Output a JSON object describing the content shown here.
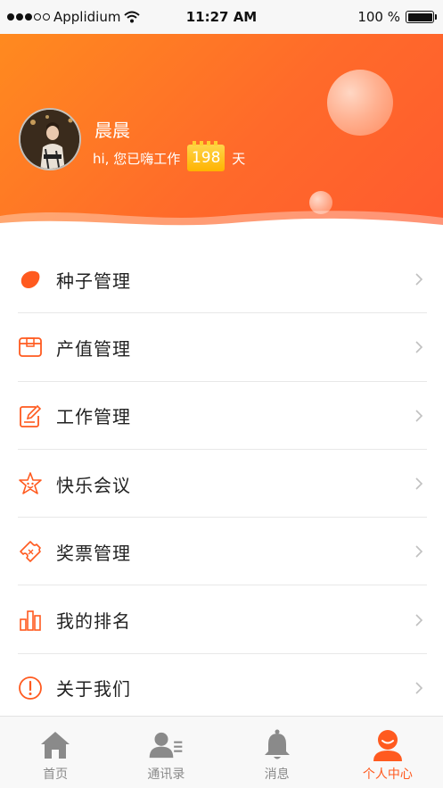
{
  "status_bar": {
    "carrier": "Applidium",
    "time": "11:27 AM",
    "battery": "100 %"
  },
  "profile": {
    "name": "晨晨",
    "greeting": "hi, 您已嗨工作",
    "days": "198",
    "days_unit": "天"
  },
  "menu": {
    "items": [
      {
        "label": "种子管理",
        "icon": "seed-icon"
      },
      {
        "label": "产值管理",
        "icon": "box-icon"
      },
      {
        "label": "工作管理",
        "icon": "edit-icon"
      },
      {
        "label": "快乐会议",
        "icon": "star-icon"
      },
      {
        "label": "奖票管理",
        "icon": "ticket-icon"
      },
      {
        "label": "我的排名",
        "icon": "ranking-icon"
      },
      {
        "label": "关于我们",
        "icon": "info-icon"
      }
    ]
  },
  "tabbar": {
    "tabs": [
      {
        "label": "首页",
        "icon": "home-icon",
        "active": false
      },
      {
        "label": "通讯录",
        "icon": "contacts-icon",
        "active": false
      },
      {
        "label": "消息",
        "icon": "bell-icon",
        "active": false
      },
      {
        "label": "个人中心",
        "icon": "person-icon",
        "active": true
      }
    ]
  },
  "colors": {
    "accent": "#ff5a1f",
    "header_start": "#ff8a1f",
    "header_end": "#ff5a2f",
    "badge": "#ffc02a",
    "tab_inactive": "#8a8a8a"
  }
}
